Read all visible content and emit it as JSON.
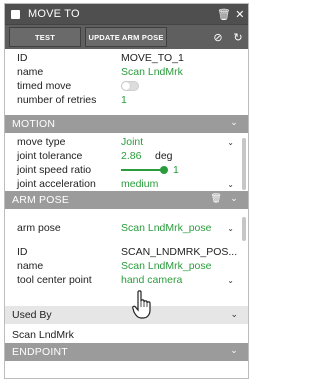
{
  "window": {
    "title": "MOVE TO"
  },
  "toolbar": {
    "test_label": "TEST",
    "update_label": "UPDATE ARM POSE"
  },
  "props": {
    "id_label": "ID",
    "id_value": "MOVE_TO_1",
    "name_label": "name",
    "name_value": "Scan LndMrk",
    "timed_label": "timed move",
    "retries_label": "number of retries",
    "retries_value": "1"
  },
  "motion": {
    "header": "MOTION",
    "move_type_label": "move type",
    "move_type_value": "Joint",
    "tol_label": "joint tolerance",
    "tol_value": "2.86",
    "tol_unit": "deg",
    "speed_label": "joint speed ratio",
    "speed_value": "1",
    "accel_label": "joint acceleration",
    "accel_value": "medium"
  },
  "arm_pose": {
    "header": "ARM POSE",
    "pose_label": "arm pose",
    "pose_value": "Scan LndMrk_pose",
    "id_label": "ID",
    "id_value": "SCAN_LNDMRK_POS...",
    "name_label": "name",
    "name_value": "Scan LndMrk_pose",
    "tcp_label": "tool center point",
    "tcp_value": "hand camera"
  },
  "used_by": {
    "header": "Used By",
    "item": "Scan LndMrk"
  },
  "endpoint": {
    "header": "ENDPOINT"
  }
}
